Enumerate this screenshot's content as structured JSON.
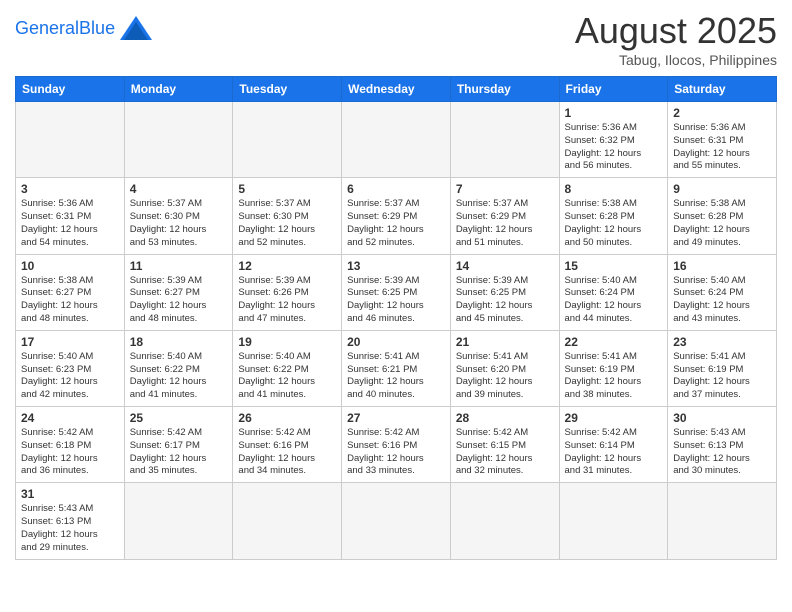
{
  "header": {
    "logo_general": "General",
    "logo_blue": "Blue",
    "title": "August 2025",
    "subtitle": "Tabug, Ilocos, Philippines"
  },
  "weekdays": [
    "Sunday",
    "Monday",
    "Tuesday",
    "Wednesday",
    "Thursday",
    "Friday",
    "Saturday"
  ],
  "weeks": [
    [
      {
        "day": "",
        "info": ""
      },
      {
        "day": "",
        "info": ""
      },
      {
        "day": "",
        "info": ""
      },
      {
        "day": "",
        "info": ""
      },
      {
        "day": "",
        "info": ""
      },
      {
        "day": "1",
        "info": "Sunrise: 5:36 AM\nSunset: 6:32 PM\nDaylight: 12 hours\nand 56 minutes."
      },
      {
        "day": "2",
        "info": "Sunrise: 5:36 AM\nSunset: 6:31 PM\nDaylight: 12 hours\nand 55 minutes."
      }
    ],
    [
      {
        "day": "3",
        "info": "Sunrise: 5:36 AM\nSunset: 6:31 PM\nDaylight: 12 hours\nand 54 minutes."
      },
      {
        "day": "4",
        "info": "Sunrise: 5:37 AM\nSunset: 6:30 PM\nDaylight: 12 hours\nand 53 minutes."
      },
      {
        "day": "5",
        "info": "Sunrise: 5:37 AM\nSunset: 6:30 PM\nDaylight: 12 hours\nand 52 minutes."
      },
      {
        "day": "6",
        "info": "Sunrise: 5:37 AM\nSunset: 6:29 PM\nDaylight: 12 hours\nand 52 minutes."
      },
      {
        "day": "7",
        "info": "Sunrise: 5:37 AM\nSunset: 6:29 PM\nDaylight: 12 hours\nand 51 minutes."
      },
      {
        "day": "8",
        "info": "Sunrise: 5:38 AM\nSunset: 6:28 PM\nDaylight: 12 hours\nand 50 minutes."
      },
      {
        "day": "9",
        "info": "Sunrise: 5:38 AM\nSunset: 6:28 PM\nDaylight: 12 hours\nand 49 minutes."
      }
    ],
    [
      {
        "day": "10",
        "info": "Sunrise: 5:38 AM\nSunset: 6:27 PM\nDaylight: 12 hours\nand 48 minutes."
      },
      {
        "day": "11",
        "info": "Sunrise: 5:39 AM\nSunset: 6:27 PM\nDaylight: 12 hours\nand 48 minutes."
      },
      {
        "day": "12",
        "info": "Sunrise: 5:39 AM\nSunset: 6:26 PM\nDaylight: 12 hours\nand 47 minutes."
      },
      {
        "day": "13",
        "info": "Sunrise: 5:39 AM\nSunset: 6:25 PM\nDaylight: 12 hours\nand 46 minutes."
      },
      {
        "day": "14",
        "info": "Sunrise: 5:39 AM\nSunset: 6:25 PM\nDaylight: 12 hours\nand 45 minutes."
      },
      {
        "day": "15",
        "info": "Sunrise: 5:40 AM\nSunset: 6:24 PM\nDaylight: 12 hours\nand 44 minutes."
      },
      {
        "day": "16",
        "info": "Sunrise: 5:40 AM\nSunset: 6:24 PM\nDaylight: 12 hours\nand 43 minutes."
      }
    ],
    [
      {
        "day": "17",
        "info": "Sunrise: 5:40 AM\nSunset: 6:23 PM\nDaylight: 12 hours\nand 42 minutes."
      },
      {
        "day": "18",
        "info": "Sunrise: 5:40 AM\nSunset: 6:22 PM\nDaylight: 12 hours\nand 41 minutes."
      },
      {
        "day": "19",
        "info": "Sunrise: 5:40 AM\nSunset: 6:22 PM\nDaylight: 12 hours\nand 41 minutes."
      },
      {
        "day": "20",
        "info": "Sunrise: 5:41 AM\nSunset: 6:21 PM\nDaylight: 12 hours\nand 40 minutes."
      },
      {
        "day": "21",
        "info": "Sunrise: 5:41 AM\nSunset: 6:20 PM\nDaylight: 12 hours\nand 39 minutes."
      },
      {
        "day": "22",
        "info": "Sunrise: 5:41 AM\nSunset: 6:19 PM\nDaylight: 12 hours\nand 38 minutes."
      },
      {
        "day": "23",
        "info": "Sunrise: 5:41 AM\nSunset: 6:19 PM\nDaylight: 12 hours\nand 37 minutes."
      }
    ],
    [
      {
        "day": "24",
        "info": "Sunrise: 5:42 AM\nSunset: 6:18 PM\nDaylight: 12 hours\nand 36 minutes."
      },
      {
        "day": "25",
        "info": "Sunrise: 5:42 AM\nSunset: 6:17 PM\nDaylight: 12 hours\nand 35 minutes."
      },
      {
        "day": "26",
        "info": "Sunrise: 5:42 AM\nSunset: 6:16 PM\nDaylight: 12 hours\nand 34 minutes."
      },
      {
        "day": "27",
        "info": "Sunrise: 5:42 AM\nSunset: 6:16 PM\nDaylight: 12 hours\nand 33 minutes."
      },
      {
        "day": "28",
        "info": "Sunrise: 5:42 AM\nSunset: 6:15 PM\nDaylight: 12 hours\nand 32 minutes."
      },
      {
        "day": "29",
        "info": "Sunrise: 5:42 AM\nSunset: 6:14 PM\nDaylight: 12 hours\nand 31 minutes."
      },
      {
        "day": "30",
        "info": "Sunrise: 5:43 AM\nSunset: 6:13 PM\nDaylight: 12 hours\nand 30 minutes."
      }
    ],
    [
      {
        "day": "31",
        "info": "Sunrise: 5:43 AM\nSunset: 6:13 PM\nDaylight: 12 hours\nand 29 minutes."
      },
      {
        "day": "",
        "info": ""
      },
      {
        "day": "",
        "info": ""
      },
      {
        "day": "",
        "info": ""
      },
      {
        "day": "",
        "info": ""
      },
      {
        "day": "",
        "info": ""
      },
      {
        "day": "",
        "info": ""
      }
    ]
  ]
}
